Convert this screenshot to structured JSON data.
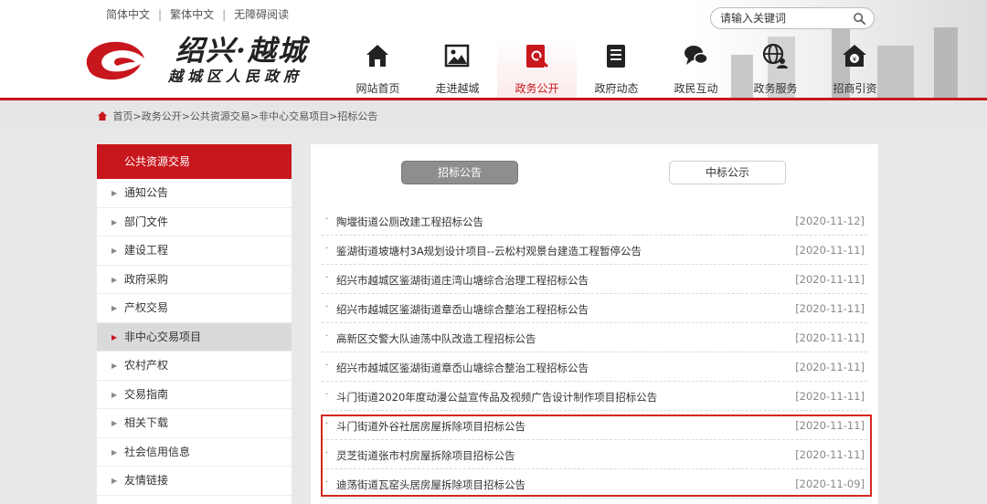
{
  "lang_bar": {
    "simplified": "简体中文",
    "traditional": "繁体中文",
    "accessible": "无障碍阅读",
    "separator": "|"
  },
  "logo": {
    "title_main": "绍兴·越城",
    "title_sub": "越城区人民政府"
  },
  "search": {
    "placeholder": "请输入关键词"
  },
  "nav": [
    {
      "label": "网站首页",
      "icon": "home-icon"
    },
    {
      "label": "走进越城",
      "icon": "picture-icon"
    },
    {
      "label": "政务公开",
      "icon": "document-search-icon",
      "active": true
    },
    {
      "label": "政府动态",
      "icon": "news-icon"
    },
    {
      "label": "政民互动",
      "icon": "chat-icon"
    },
    {
      "label": "政务服务",
      "icon": "globe-user-icon"
    },
    {
      "label": "招商引资",
      "icon": "investment-house-icon"
    }
  ],
  "breadcrumb": "首页>政务公开>公共资源交易>非中心交易项目>招标公告",
  "sidebar": {
    "title": "公共资源交易",
    "items": [
      {
        "label": "通知公告"
      },
      {
        "label": "部门文件"
      },
      {
        "label": "建设工程"
      },
      {
        "label": "政府采购"
      },
      {
        "label": "产权交易"
      },
      {
        "label": "非中心交易项目",
        "active": true
      },
      {
        "label": "农村产权"
      },
      {
        "label": "交易指南"
      },
      {
        "label": "相关下载"
      },
      {
        "label": "社会信用信息"
      },
      {
        "label": "友情链接"
      }
    ]
  },
  "tabs": {
    "active": "招标公告",
    "inactive": "中标公示"
  },
  "list_bullet": "·",
  "announcements": [
    {
      "title": "陶堰街道公厕改建工程招标公告",
      "date": "[2020-11-12]"
    },
    {
      "title": "鉴湖街道坡塘村3A规划设计项目--云松村观景台建造工程暂停公告",
      "date": "[2020-11-11]"
    },
    {
      "title": "绍兴市越城区鉴湖街道庄湾山塘综合治理工程招标公告",
      "date": "[2020-11-11]"
    },
    {
      "title": "绍兴市越城区鉴湖街道章岙山塘综合整治工程招标公告",
      "date": "[2020-11-11]"
    },
    {
      "title": "高新区交警大队迪荡中队改造工程招标公告",
      "date": "[2020-11-11]"
    },
    {
      "title": "绍兴市越城区鉴湖街道章岙山塘综合整治工程招标公告",
      "date": "[2020-11-11]"
    },
    {
      "title": "斗门街道2020年度动漫公益宣传品及视频广告设计制作项目招标公告",
      "date": "[2020-11-11]"
    },
    {
      "title": "斗门街道外谷社居房屋拆除项目招标公告",
      "date": "[2020-11-11]"
    },
    {
      "title": "灵芝街道张市村房屋拆除项目招标公告",
      "date": "[2020-11-11]"
    },
    {
      "title": "迪荡街道瓦窑头居房屋拆除项目招标公告",
      "date": "[2020-11-09]"
    }
  ],
  "colors": {
    "brand_red": "#c8161d",
    "highlight_red": "#d4261e",
    "tab_gray": "#8e8e8e"
  }
}
